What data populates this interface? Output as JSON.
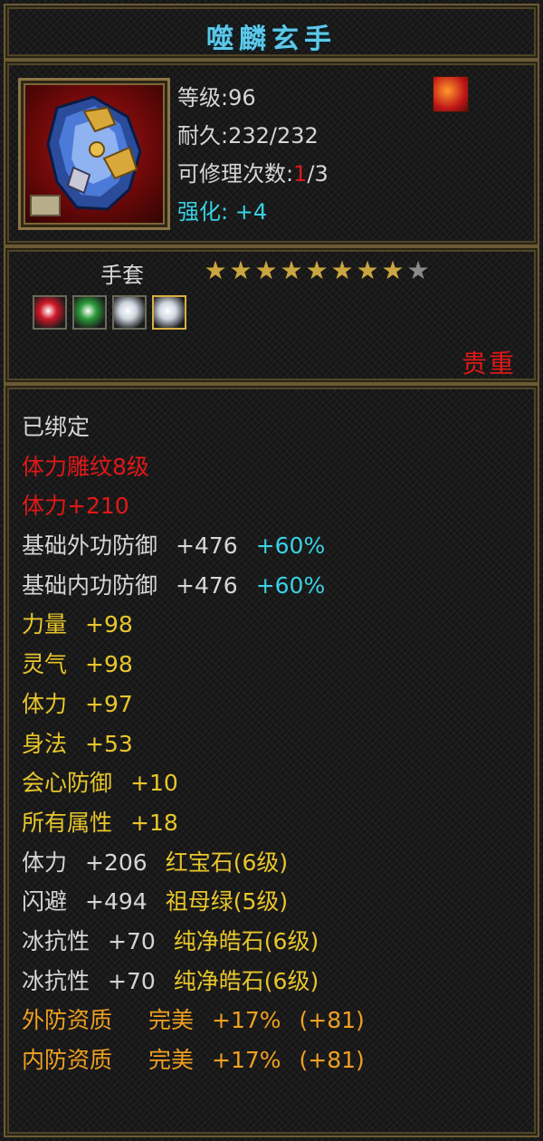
{
  "item": {
    "name": "噬麟玄手",
    "level_label": "等级",
    "level": "96",
    "durability_label": "耐久",
    "durability": "232/232",
    "repair_label": "可修理次数",
    "repair_current": "1",
    "repair_max": "/3",
    "enhance_label": "强化:",
    "enhance_value": "+4",
    "type": "手套",
    "stars_filled": 8,
    "stars_total": 9,
    "rarity": "贵重"
  },
  "gems": [
    {
      "icon": "ruby-gem-icon",
      "color": "#d01828"
    },
    {
      "icon": "emerald-gem-icon",
      "color": "#2a9a3a"
    },
    {
      "icon": "diamond-gem-icon",
      "color": "#cfd6e0"
    },
    {
      "icon": "diamond-gem-icon",
      "color": "#cfd6e0"
    }
  ],
  "attributes": {
    "bound": "已绑定",
    "engraving": "体力雕纹8级",
    "engraving_bonus": "体力+210",
    "base_outer_def_label": "基础外功防御",
    "base_outer_def_value": "+476",
    "base_outer_def_pct": "+60%",
    "base_inner_def_label": "基础内功防御",
    "base_inner_def_value": "+476",
    "base_inner_def_pct": "+60%",
    "strength_label": "力量",
    "strength_value": "+98",
    "spirit_label": "灵气",
    "spirit_value": "+98",
    "stamina_label": "体力",
    "stamina_value": "+97",
    "agility_label": "身法",
    "agility_value": "+53",
    "crit_def_label": "会心防御",
    "crit_def_value": "+10",
    "all_attr_label": "所有属性",
    "all_attr_value": "+18",
    "gem1_stat": "体力",
    "gem1_value": "+206",
    "gem1_name": "红宝石(6级)",
    "gem2_stat": "闪避",
    "gem2_value": "+494",
    "gem2_name": "祖母绿(5级)",
    "gem3_stat": "冰抗性",
    "gem3_value": "+70",
    "gem3_name": "纯净皓石(6级)",
    "gem4_stat": "冰抗性",
    "gem4_value": "+70",
    "gem4_name": "纯净皓石(6级)",
    "outer_quality_label": "外防资质",
    "outer_quality_grade": "完美",
    "outer_quality_pct": "+17%",
    "outer_quality_bonus": "(+81)",
    "inner_quality_label": "内防资质",
    "inner_quality_grade": "完美",
    "inner_quality_pct": "+17%",
    "inner_quality_bonus": "(+81)"
  },
  "colors": {
    "title": "#5ec8e8",
    "red": "#e01818",
    "gold": "#e8c62c",
    "cyan": "#38d2e4",
    "orange": "#f0a020",
    "border": "#6a5a34"
  }
}
